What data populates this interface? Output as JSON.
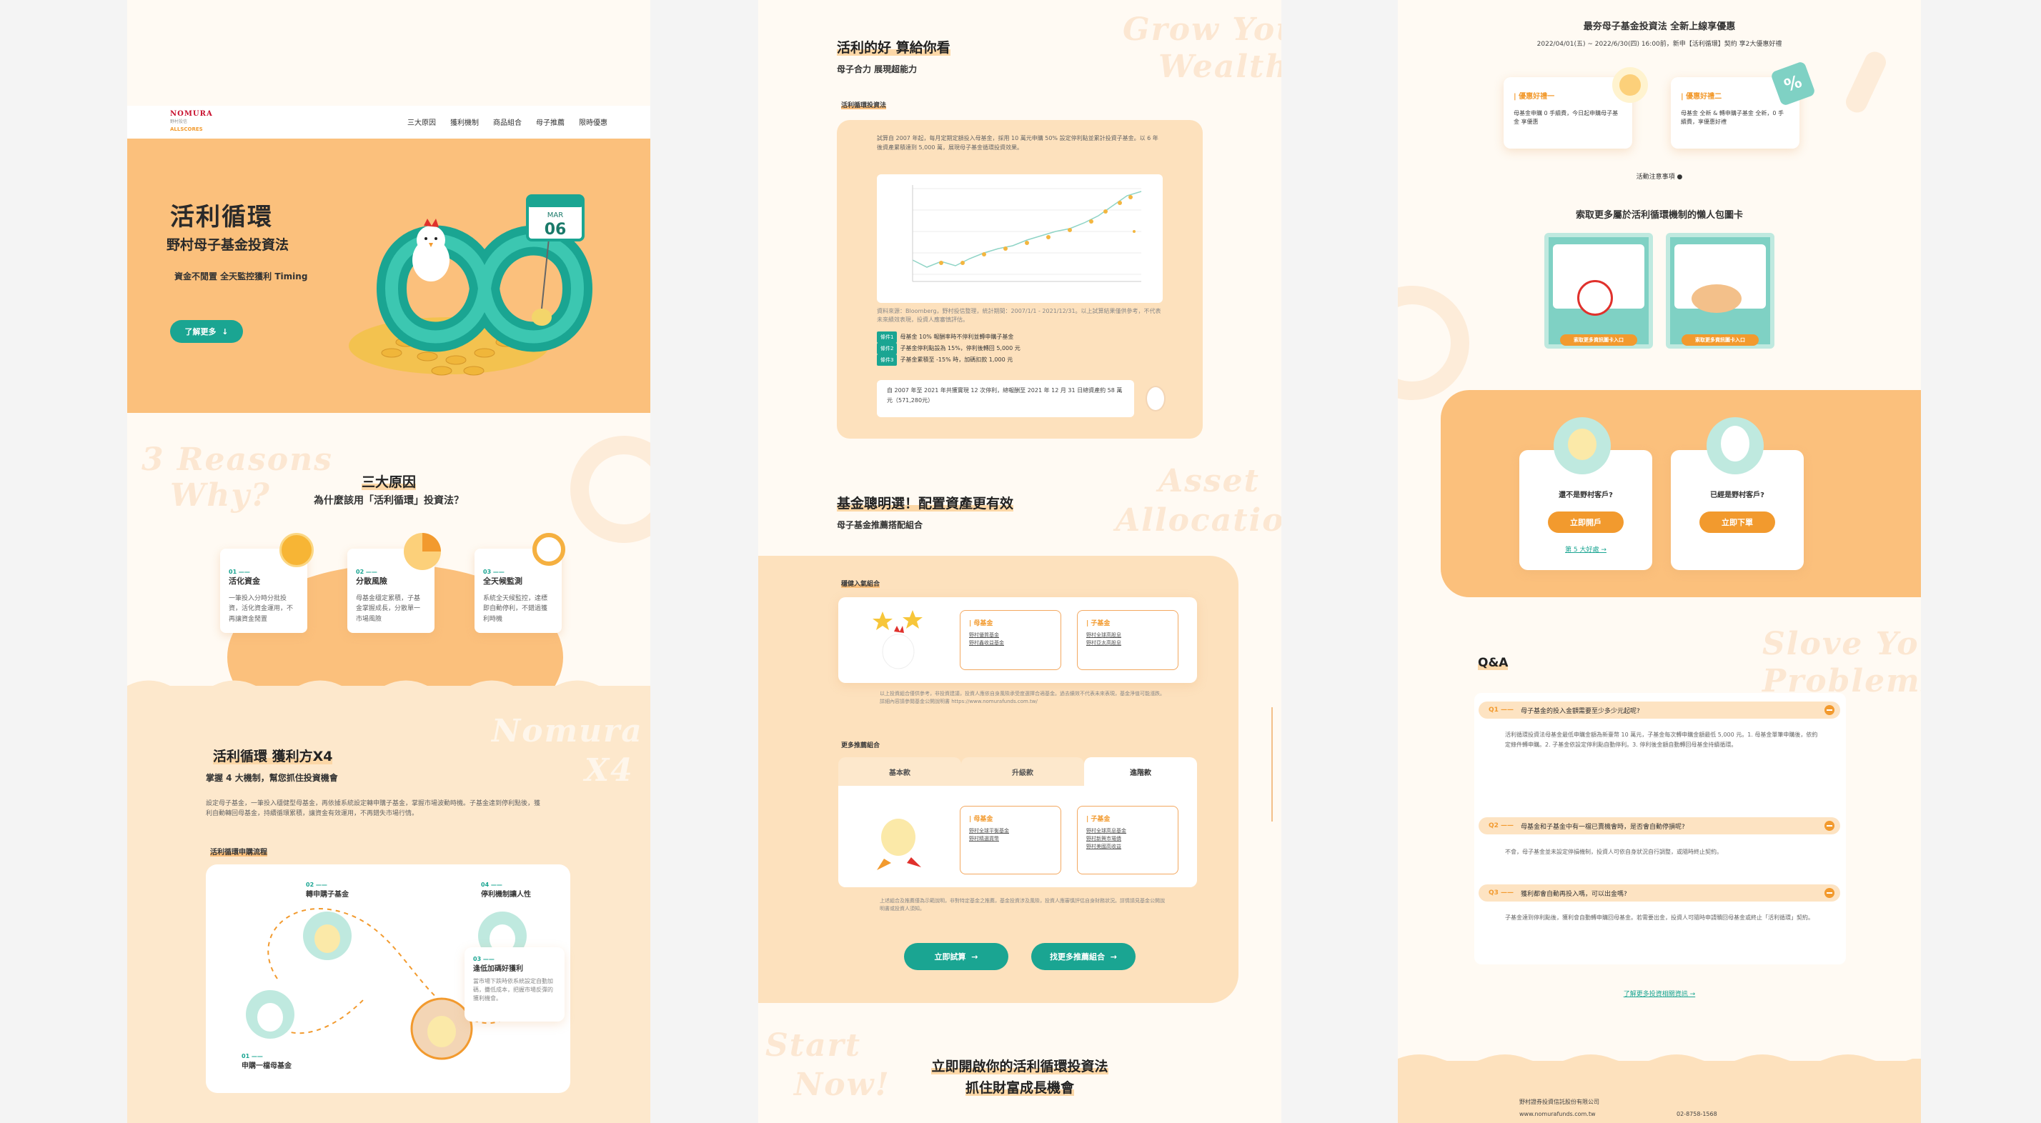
{
  "colors": {
    "accent": "#f29a2e",
    "teal": "#1aa592",
    "peach": "#fbc07c",
    "cream": "#fffaf3"
  },
  "page1": {
    "logo": {
      "brand": "NOMURA",
      "tagline": "野村投信",
      "sub": "ALLSCORES"
    },
    "nav": [
      "三大原因",
      "獲利機制",
      "商品組合",
      "母子推薦",
      "限時優惠"
    ],
    "hero": {
      "title": "活利循環",
      "subtitle": "野村母子基金投資法",
      "tagline": "資金不閒置 全天監控獲利 Timing",
      "button": "了解更多",
      "calendar_month": "MAR",
      "calendar_day": "06"
    },
    "reasons": {
      "bg_word1": "3 Reasons",
      "bg_word2": "Why?",
      "title": "三大原因",
      "subtitle": "為什麼該用「活利循環」投資法？",
      "items": [
        {
          "num": "01 ——",
          "title": "活化資金",
          "desc": "一筆投入分時分批投資，活化資金運用，不再讓資金閒置"
        },
        {
          "num": "02 ——",
          "title": "分散風險",
          "desc": "母基金穩定累積，子基金掌握成長，分散單一市場風險"
        },
        {
          "num": "03 ——",
          "title": "全天候監測",
          "desc": "系統全天候監控，達標即自動停利，不錯過獲利時機"
        }
      ]
    },
    "mechanism": {
      "bg_word1": "Nomura",
      "bg_word2": "X4",
      "title": "活利循環 獲利方X4",
      "subtitle": "掌握 4 大機制，幫您抓住投資機會",
      "desc": "設定母子基金，一筆投入穩健型母基金，再依據系統設定轉申購子基金，掌握市場波動時機。子基金達到停利點後，獲利自動轉回母基金，持續循環累積，讓資金有效運用，不再錯失市場行情。",
      "flow_label": "活利循環申購流程",
      "steps": [
        {
          "num": "01 ——",
          "title": "申購一檔母基金"
        },
        {
          "num": "02 ——",
          "title": "轉申購子基金"
        },
        {
          "num": "03 ——",
          "title": "逢低加碼好獲利",
          "desc": "當市場下跌時依系統設定自動加碼，攤低成本，把握市場反彈的獲利機會。"
        },
        {
          "num": "04 ——",
          "title": "停利機制讓人性"
        }
      ]
    }
  },
  "page2": {
    "bg_word1": "Grow Your",
    "bg_word2": "Wealth",
    "title": "活利的好 算給你看",
    "subtitle": "母子合力 展現超能力",
    "case_label": "活利循環投資法",
    "case_desc": "試算自 2007 年起，每月定期定額投入母基金，採用 10 萬元申購 50% 設定停利點並累計投資子基金。以 6 年後資產累積達到 5,000 萬，展現母子基金循環投資效果。",
    "chart_note": "資料來源：Bloomberg，野村投信整理，統計期間：2007/1/1 - 2021/12/31。以上試算結果僅供參考，不代表未來績效表現，投資人應審慎評估。",
    "legends": [
      {
        "tag": "條件1",
        "text": "母基金 10% 報酬率時不停利並轉申購子基金"
      },
      {
        "tag": "條件2",
        "text": "子基金停利點設為 15%，停利後轉回 5,000 元"
      },
      {
        "tag": "條件3",
        "text": "子基金累積至 -15% 時，加碼扣款 1,000 元"
      }
    ],
    "result": "自 2007 年至 2021 年共獲實現 12 次停利，總報酬至 2021 年 12 月 31 日總資產約 58 萬元（571,280元）",
    "alloc": {
      "bg_word1": "Asset",
      "bg_word2": "Allocation",
      "title": "基金聰明選！配置資產更有效",
      "subtitle": "母子基金推薦搭配組合"
    },
    "popular_label": "穩健入氣組合",
    "popular": {
      "mother": {
        "title": "母基金",
        "links": [
          "野村優質基金",
          "野村鑫收益基金"
        ]
      },
      "child": {
        "title": "子基金",
        "links": [
          "野村全球高股息",
          "野村亞太高股息"
        ]
      }
    },
    "popular_note": "以上投資組合僅供參考，非投資建議，投資人應依自身風險承受度選擇合適基金。過去績效不代表未來表現，基金淨值可能漲跌。詳細內容請參閱基金公開說明書 https://www.nomurafunds.com.tw/",
    "more_label": "更多推薦組合",
    "tabs": [
      "基本款",
      "升級款",
      "進階款"
    ],
    "more": {
      "mother": {
        "title": "母基金",
        "links": [
          "野村全球平衡基金",
          "野村精選貨幣"
        ]
      },
      "child": {
        "title": "子基金",
        "links": [
          "野村全球高息基金",
          "野村新興市場債",
          "野村美國高收益"
        ]
      }
    },
    "more_note": "上述組合及推薦僅為示範說明，非對特定基金之推薦，基金投資涉及風險，投資人應審慎評估自身財務狀況。詳情請見基金公開說明書或投資人須知。",
    "btn_start": "立即試算",
    "btn_more": "找更多推薦組合",
    "cta": {
      "bg_word1": "Start",
      "bg_word2": "Now!",
      "line1": "立即開啟你的活利循環投資法",
      "line2": "抓住財富成長機會"
    }
  },
  "page3": {
    "promo_title": "最夯母子基金投資法 全新上線享優惠",
    "promo_date": "2022/04/01(五) ~ 2022/6/30(四) 16:00前，新申【活利循環】契約 享2大優惠好禮",
    "offers": [
      {
        "title": "優惠好禮一",
        "desc": "母基金申購 0 手續費，今日起申購母子基金 享優惠"
      },
      {
        "title": "優惠好禮二",
        "desc": "母基金 全新 & 轉申購子基金 全新，0 手續費，享優惠好禮"
      }
    ],
    "offer_link": "活動注意事項",
    "cards_title": "索取更多屬於活利循環機制的懶人包圖卡",
    "cards": [
      {
        "caption": "索取更多資訊圖卡入口"
      },
      {
        "caption": "索取更多資訊圖卡入口"
      }
    ],
    "accounts": [
      {
        "q": "還不是野村客戶?",
        "btn": "立即開戶",
        "link": "第 5 大好處 →"
      },
      {
        "q": "已經是野村客戶?",
        "btn": "立即下單"
      }
    ],
    "qa": {
      "bg_word1": "Slove Your",
      "bg_word2": "Problems!",
      "title": "Q&A",
      "items": [
        {
          "num": "Q1 ——",
          "q": "母子基金的投入金額需要至少多少元起呢?",
          "a": "活利循環投資法母基金最低申購金額為新臺幣 10 萬元，子基金每次轉申購金額最低 5,000 元。1. 母基金單筆申購後，依約定條件轉申購。2. 子基金依設定停利點自動停利。3. 停利後金額自動轉回母基金持續循環。"
        },
        {
          "num": "Q2 ——",
          "q": "母基金和子基金中有一檔已賣機會時，是否會自動停損呢?",
          "a": "不會，母子基金並未設定停損機制，投資人可依自身狀況自行調整，或隨時終止契約。"
        },
        {
          "num": "Q3 ——",
          "q": "獲利都會自動再投入嗎，可以出金嗎?",
          "a": "子基金達到停利點後，獲利會自動轉申購回母基金。若需要出金，投資人可隨時申請贖回母基金或終止「活利循環」契約。"
        }
      ],
      "more_link": "了解更多投資相關資訊 →"
    },
    "footer": {
      "company": "野村證券投資信託股份有限公司",
      "url": "www.nomurafunds.com.tw",
      "phone": "02-8758-1568"
    }
  }
}
